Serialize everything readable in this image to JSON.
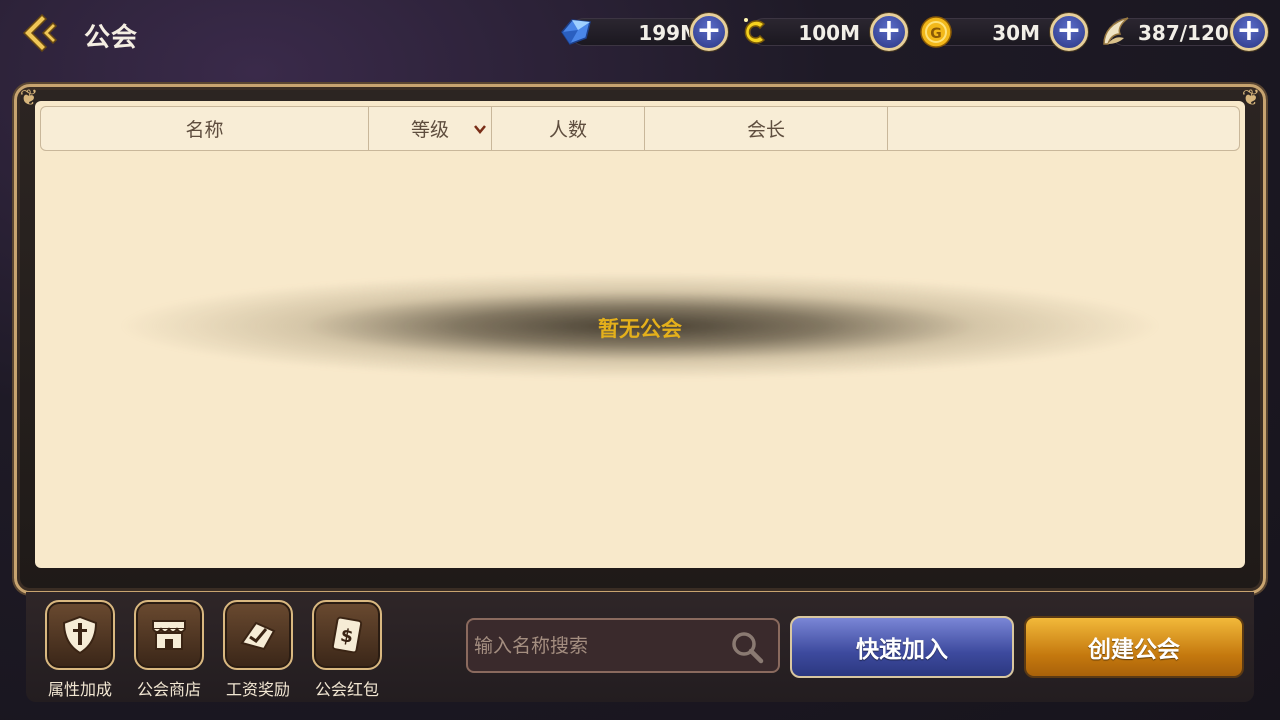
{
  "header": {
    "title": "公会"
  },
  "resources": [
    {
      "name": "diamond",
      "icon": "diamond-icon",
      "value": "199M"
    },
    {
      "name": "coupon",
      "icon": "c-coin-icon",
      "value": "100M"
    },
    {
      "name": "gold",
      "icon": "gold-coin-icon",
      "value": "30M"
    },
    {
      "name": "stamina",
      "icon": "wing-icon",
      "value": "387/120"
    }
  ],
  "table": {
    "columns": [
      "名称",
      "等级",
      "人数",
      "会长",
      ""
    ],
    "empty_text": "暂无公会"
  },
  "features": [
    {
      "label": "属性加成",
      "icon": "shield-sword-icon"
    },
    {
      "label": "公会商店",
      "icon": "shop-icon"
    },
    {
      "label": "工资奖励",
      "icon": "salary-icon"
    },
    {
      "label": "公会红包",
      "icon": "red-envelope-icon"
    }
  ],
  "search": {
    "placeholder": "输入名称搜索",
    "value": ""
  },
  "actions": {
    "quick_join": "快速加入",
    "create_guild": "创建公会"
  },
  "colors": {
    "panel_bg": "#f8e9cb",
    "empty_text": "#e4b01b",
    "blue_button": "#3d4a9e",
    "gold_button": "#c4780e",
    "frame_border": "#c8a470"
  }
}
